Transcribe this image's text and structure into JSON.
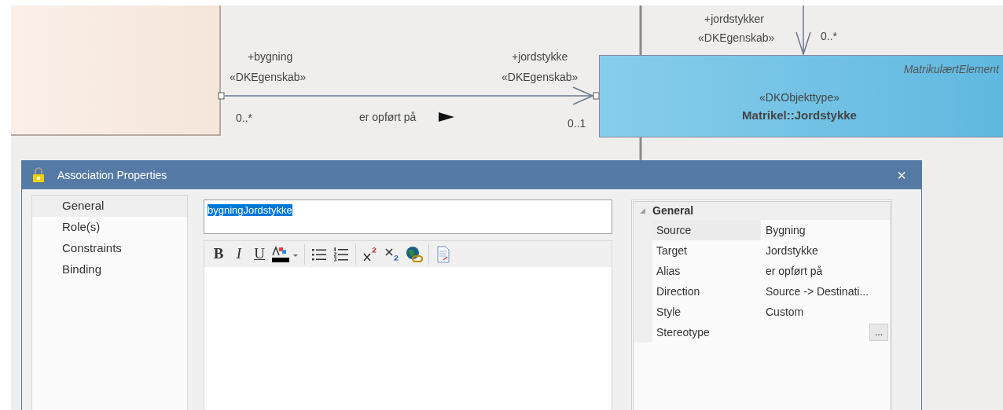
{
  "association": {
    "source_role": "+bygning",
    "source_stereotype": "«DKEgenskab»",
    "source_multiplicity": "0..*",
    "name": "er opført på",
    "target_role": "+jordstykke",
    "target_stereotype": "«DKEgenskab»",
    "target_multiplicity": "0..1"
  },
  "incoming_association": {
    "role": "+jordstykker",
    "stereotype": "«DKEgenskab»",
    "multiplicity": "0..*"
  },
  "target_class": {
    "parent": "MatrikulærtElement",
    "stereotype": "«DKObjekttype»",
    "name": "Matrikel::Jordstykke"
  },
  "dialog": {
    "title": "Association Properties",
    "close": "×",
    "nav": [
      {
        "label": "General",
        "selected": true
      },
      {
        "label": "Role(s)",
        "selected": false
      },
      {
        "label": "Constraints",
        "selected": false
      },
      {
        "label": "Binding",
        "selected": false
      }
    ],
    "name_field": {
      "value": "bygningJordstykke",
      "text_selected": true
    },
    "toolbar": [
      {
        "kind": "bold",
        "label": "B"
      },
      {
        "kind": "italic",
        "label": "I"
      },
      {
        "kind": "underline",
        "label": "U"
      },
      {
        "kind": "color"
      },
      {
        "kind": "separator"
      },
      {
        "kind": "bullets"
      },
      {
        "kind": "numbering"
      },
      {
        "kind": "separator"
      },
      {
        "kind": "superscript"
      },
      {
        "kind": "subscript"
      },
      {
        "kind": "hyperlink"
      },
      {
        "kind": "separator"
      },
      {
        "kind": "document"
      }
    ],
    "properties": {
      "group": "General",
      "expanded": true,
      "rows": [
        {
          "name": "Source",
          "value": "Bygning",
          "selected": true,
          "kind": "text"
        },
        {
          "name": "Target",
          "value": "Jordstykke",
          "selected": false,
          "kind": "text"
        },
        {
          "name": "Alias",
          "value": "er opført på",
          "selected": false,
          "kind": "text"
        },
        {
          "name": "Direction",
          "value": "Source -> Destinati...",
          "selected": false,
          "kind": "text"
        },
        {
          "name": "Style",
          "value": "Custom",
          "selected": false,
          "kind": "text"
        },
        {
          "name": "Stereotype",
          "button": "...",
          "selected": false,
          "kind": "picker"
        }
      ]
    }
  }
}
